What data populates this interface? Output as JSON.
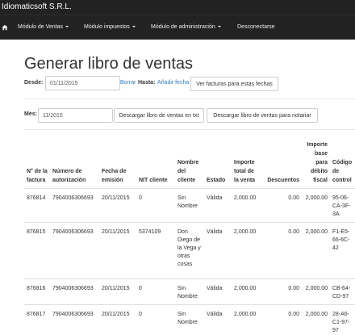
{
  "app": {
    "brand": "Idiomaticsoft S.R.L."
  },
  "nav": {
    "home_icon": "home-icon",
    "items": [
      "Módulo de Ventas",
      "Módulo impuestos",
      "Módulo de administración",
      "Desconectarse"
    ]
  },
  "page": {
    "title": "Generar libro de ventas"
  },
  "dates": {
    "desde_label": "Desde:",
    "desde_value": "01/11/2015",
    "borrar_link": "Borrar",
    "hasta_label": "Hasta:",
    "hasta_link": "Añadir fecha",
    "ver_button": "Ver facturas para estas fechas"
  },
  "month": {
    "mes_label": "Mes:",
    "mes_value": "11/2015",
    "download_txt": "Descargar libro de ventas en txt",
    "download_notary": "Descargar libro de ventas para notariar"
  },
  "table": {
    "headers": [
      "N° de la factura",
      "Número de autorización",
      "Fecha de emisión",
      "NIT cliente",
      "Nombre del cliente",
      "Estado",
      "Importe total de la venta",
      "Descuentos",
      "Importe base para débito fiscal",
      "Código de control"
    ],
    "rows": [
      [
        "876814",
        "7904006306693",
        "20/11/2015",
        "0",
        "Sin Nombre",
        "Válida",
        "2,000.00",
        "0.00",
        "2,000.00",
        "95-06-CA-3F-3A"
      ],
      [
        "876815",
        "7904006306693",
        "20/11/2015",
        "5374109",
        "Don Diego de la Vega y otras cosas",
        "Válida",
        "2,000.00",
        "0.00",
        "2,000.00",
        "F1-E5-66-6C-42"
      ],
      [
        "876816",
        "7904006306693",
        "20/11/2015",
        "0",
        "Sin Nombre",
        "Válida",
        "2,000.00",
        "0.00",
        "2,000.00",
        "CB-64-CD-97"
      ],
      [
        "876817",
        "7904006306693",
        "20/11/2015",
        "0",
        "Sin Nombre",
        "Válida",
        "2,000.00",
        "0.00",
        "2,000.00",
        "28-A6-C1-97-97"
      ]
    ]
  }
}
